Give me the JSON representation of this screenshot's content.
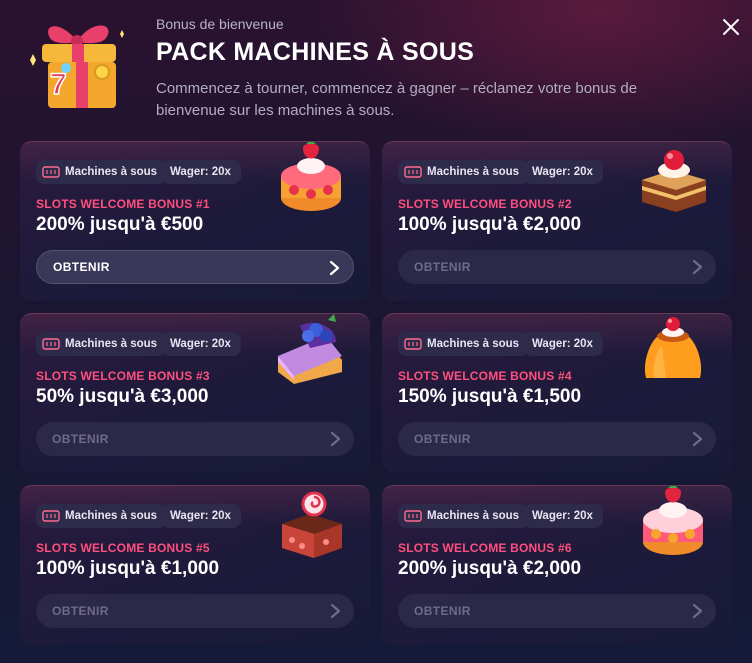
{
  "header": {
    "subtitle": "Bonus de bienvenue",
    "title": "PACK MACHINES À SOUS",
    "description": "Commencez à tourner, commencez à gagner – réclamez votre bonus de bienvenue sur les machines à sous.",
    "gift_icon": "gift-box-icon",
    "close_icon": "close-icon"
  },
  "colors": {
    "accent": "#ff4f7e",
    "card_bg": "#1d1a3a",
    "tag_bg": "#2e2a4a",
    "button_bg": "#2b2947"
  },
  "bonuses": [
    {
      "tag_category": "Machines à sous",
      "tag_wager": "Wager: 20x",
      "label": "SLOTS WELCOME BONUS #1",
      "amount": "200% jusqu'à €500",
      "button": "OBTENIR",
      "button_state": "active",
      "image": "strawberry-cake"
    },
    {
      "tag_category": "Machines à sous",
      "tag_wager": "Wager: 20x",
      "label": "SLOTS WELCOME BONUS #2",
      "amount": "100% jusqu'à €2,000",
      "button": "OBTENIR",
      "button_state": "disabled",
      "image": "layer-cake"
    },
    {
      "tag_category": "Machines à sous",
      "tag_wager": "Wager: 20x",
      "label": "SLOTS WELCOME BONUS #3",
      "amount": "50% jusqu'à €3,000",
      "button": "OBTENIR",
      "button_state": "disabled",
      "image": "blueberry-cheesecake"
    },
    {
      "tag_category": "Machines à sous",
      "tag_wager": "Wager: 20x",
      "label": "SLOTS WELCOME BONUS #4",
      "amount": "150% jusqu'à €1,500",
      "button": "OBTENIR",
      "button_state": "disabled",
      "image": "pudding"
    },
    {
      "tag_category": "Machines à sous",
      "tag_wager": "Wager: 20x",
      "label": "SLOTS WELCOME BONUS #5",
      "amount": "100% jusqu'à €1,000",
      "button": "OBTENIR",
      "button_state": "disabled",
      "image": "cherry-cake"
    },
    {
      "tag_category": "Machines à sous",
      "tag_wager": "Wager: 20x",
      "label": "SLOTS WELCOME BONUS #6",
      "amount": "200% jusqu'à €2,000",
      "button": "OBTENIR",
      "button_state": "disabled",
      "image": "strawberry-cake"
    }
  ]
}
